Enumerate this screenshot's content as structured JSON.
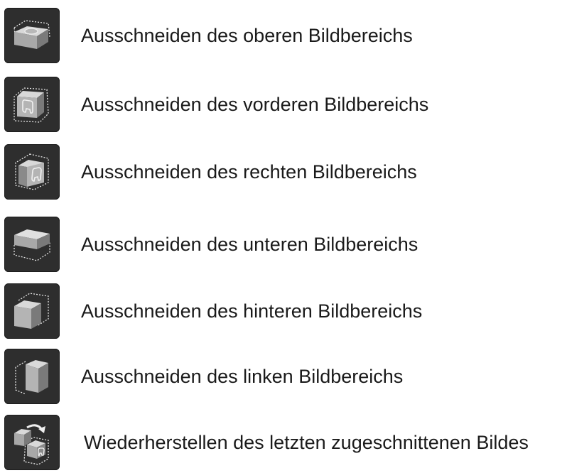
{
  "items": [
    {
      "icon": "crop-top-icon",
      "label": "Ausschneiden des oberen Bildbereichs"
    },
    {
      "icon": "crop-front-icon",
      "label": "Ausschneiden des vorderen Bildbereichs"
    },
    {
      "icon": "crop-right-icon",
      "label": "Ausschneiden des rechten Bildbereichs"
    },
    {
      "icon": "crop-bottom-icon",
      "label": "Ausschneiden des unteren Bildbereichs"
    },
    {
      "icon": "crop-back-icon",
      "label": "Ausschneiden des hinteren Bildbereichs"
    },
    {
      "icon": "crop-left-icon",
      "label": "Ausschneiden des linken Bildbereichs"
    },
    {
      "icon": "undo-crop-icon",
      "label": "Wiederherstellen des letzten zugeschnittenen Bildes"
    }
  ],
  "colors": {
    "button_bg": "#2e2e2e",
    "cube_light": "#d9d9d9",
    "cube_mid": "#a8a8a8",
    "cube_dark": "#7a7a7a",
    "dotted_outline": "#e6e6e6",
    "text": "#1a1a1a"
  }
}
